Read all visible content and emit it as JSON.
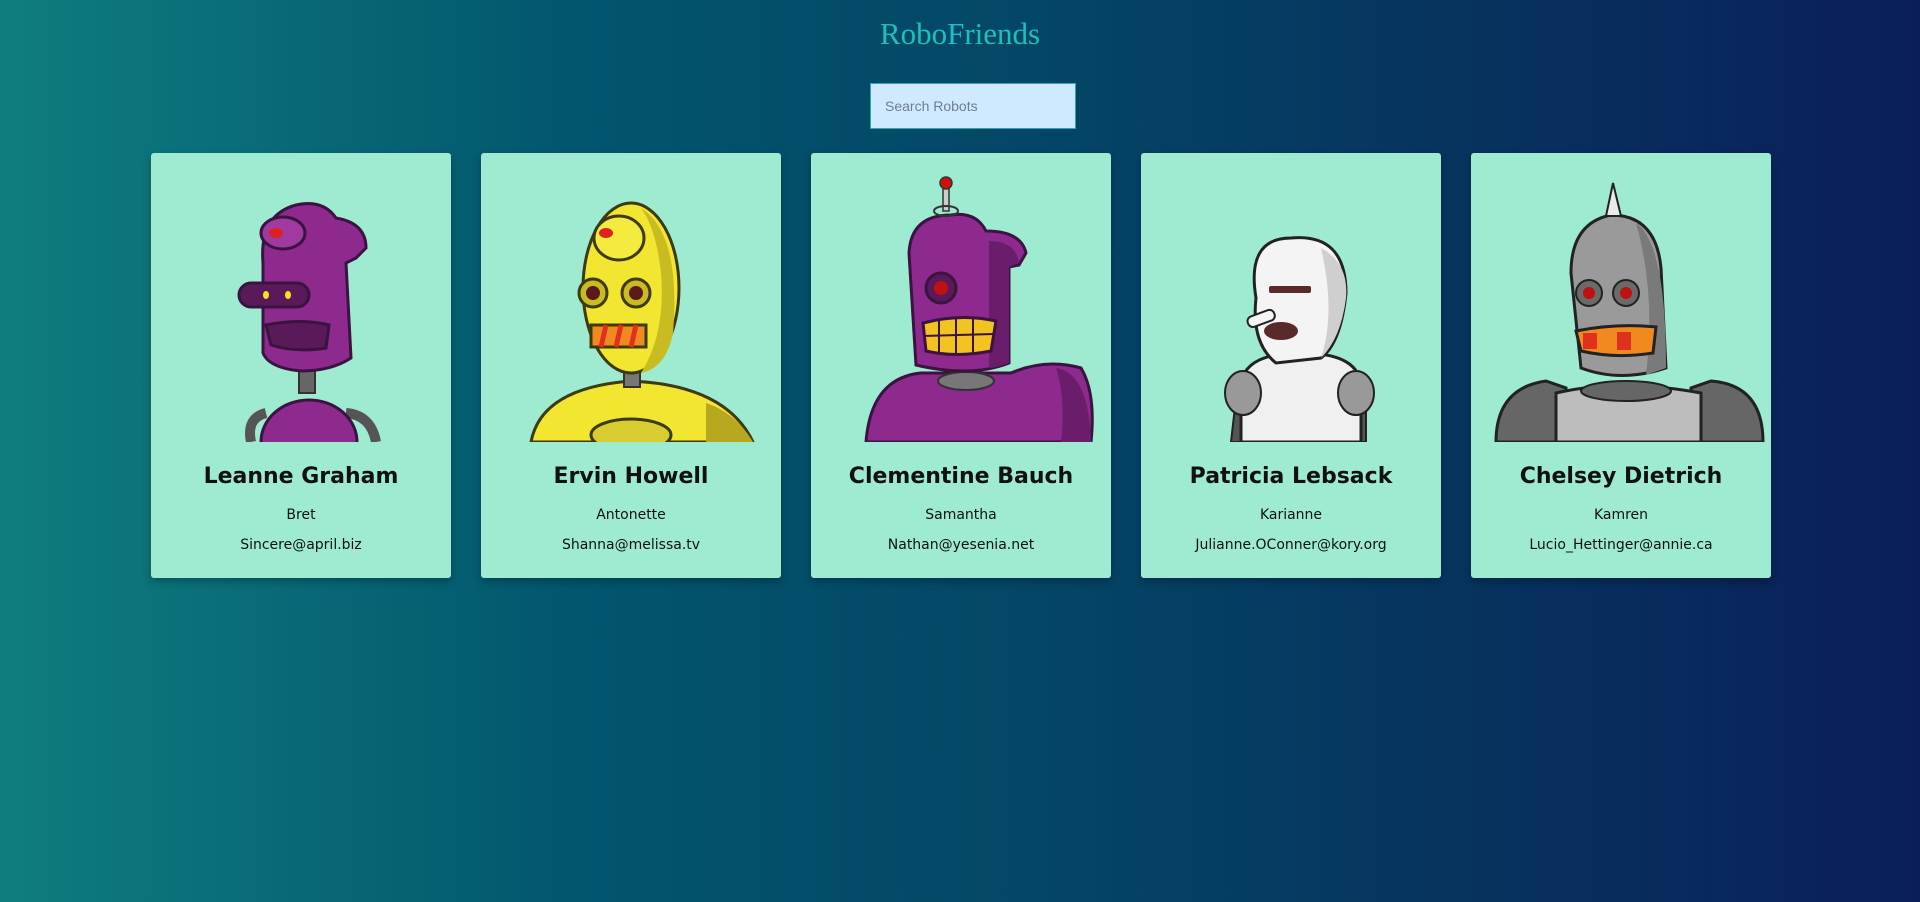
{
  "header": {
    "title": "RoboFriends"
  },
  "search": {
    "placeholder": "Search Robots",
    "value": ""
  },
  "robots": [
    {
      "name": "Leanne Graham",
      "username": "Bret",
      "email": "Sincere@april.biz",
      "color": "#8e2a8e"
    },
    {
      "name": "Ervin Howell",
      "username": "Antonette",
      "email": "Shanna@melissa.tv",
      "color": "#f2e631"
    },
    {
      "name": "Clementine Bauch",
      "username": "Samantha",
      "email": "Nathan@yesenia.net",
      "color": "#8e2a8e"
    },
    {
      "name": "Patricia Lebsack",
      "username": "Karianne",
      "email": "Julianne.OConner@kory.org",
      "color": "#f0f0f0"
    },
    {
      "name": "Chelsey Dietrich",
      "username": "Kamren",
      "email": "Lucio_Hettinger@annie.ca",
      "color": "#9a9a9a"
    }
  ]
}
